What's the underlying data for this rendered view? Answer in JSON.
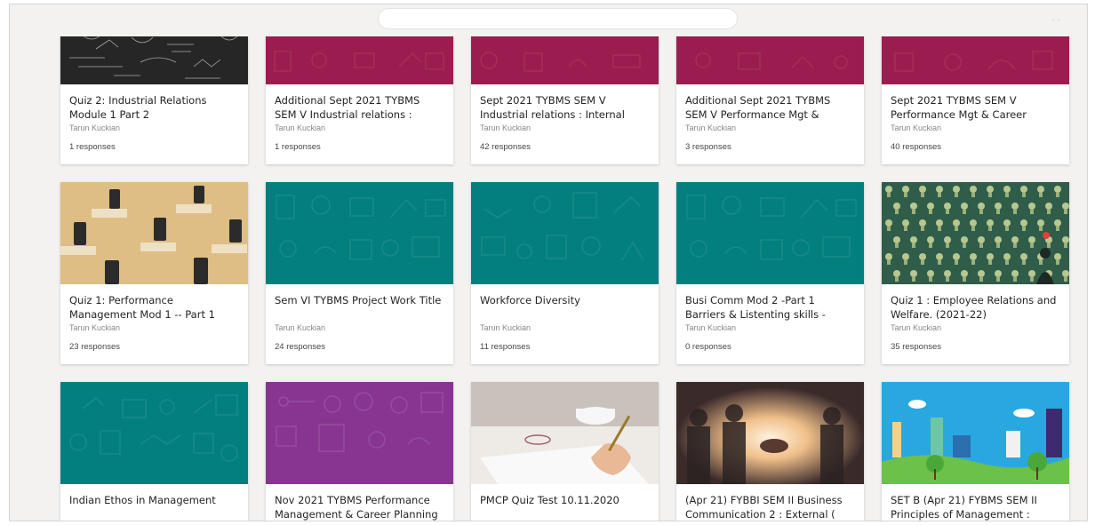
{
  "forms": [
    {
      "title": "Quiz 2: Industrial Relations Module 1 Part 2",
      "owner": "Tarun Kuckian",
      "responses": "1 responses",
      "thumb": "chalkboard-photo"
    },
    {
      "title": "Additional Sept 2021 TYBMS SEM V Industrial relations :",
      "owner": "Tarun Kuckian",
      "responses": "1 responses",
      "thumb": "maroon-pattern"
    },
    {
      "title": "Sept 2021 TYBMS SEM V Industrial relations : Internal",
      "owner": "Tarun Kuckian",
      "responses": "42 responses",
      "thumb": "maroon-pattern"
    },
    {
      "title": "Additional Sept 2021 TYBMS SEM V Performance Mgt &",
      "owner": "Tarun Kuckian",
      "responses": "3 responses",
      "thumb": "maroon-pattern"
    },
    {
      "title": "Sept 2021 TYBMS SEM V Performance Mgt & Career",
      "owner": "Tarun Kuckian",
      "responses": "40 responses",
      "thumb": "maroon-pattern"
    },
    {
      "title": "Quiz 1: Performance Management Mod 1 -- Part 1",
      "owner": "Tarun Kuckian",
      "responses": "23 responses",
      "thumb": "exam-hall-photo"
    },
    {
      "title": "Sem VI TYBMS Project Work Title",
      "owner": "Tarun Kuckian",
      "responses": "24 responses",
      "thumb": "teal-pattern"
    },
    {
      "title": "Workforce Diversity",
      "owner": "Tarun Kuckian",
      "responses": "11 responses",
      "thumb": "teal-pattern"
    },
    {
      "title": "Busi Comm Mod 2 -Part 1 Barriers & Listenting skills -",
      "owner": "Tarun Kuckian",
      "responses": "0 responses",
      "thumb": "teal-pattern"
    },
    {
      "title": "Quiz 1 : Employee Relations and Welfare. (2021-22)",
      "owner": "Tarun Kuckian",
      "responses": "35 responses",
      "thumb": "lightbulbs-illustration"
    },
    {
      "title": "Indian Ethos in Management",
      "thumb": "teal-pattern"
    },
    {
      "title": "Nov 2021 TYBMS Performance Management & Career Planning",
      "thumb": "purple-pattern"
    },
    {
      "title": "PMCP Quiz Test 10.11.2020",
      "thumb": "writing-photo"
    },
    {
      "title": "(Apr 21) FYBBI SEM II Business Communication 2 : External (",
      "thumb": "handshake-photo"
    },
    {
      "title": "SET B (Apr 21) FYBMS SEM II Principles of Management :",
      "thumb": "city-illustration"
    }
  ],
  "colors": {
    "maroon": "#9b1d4f",
    "teal": "#037f80",
    "purple": "#873591"
  }
}
